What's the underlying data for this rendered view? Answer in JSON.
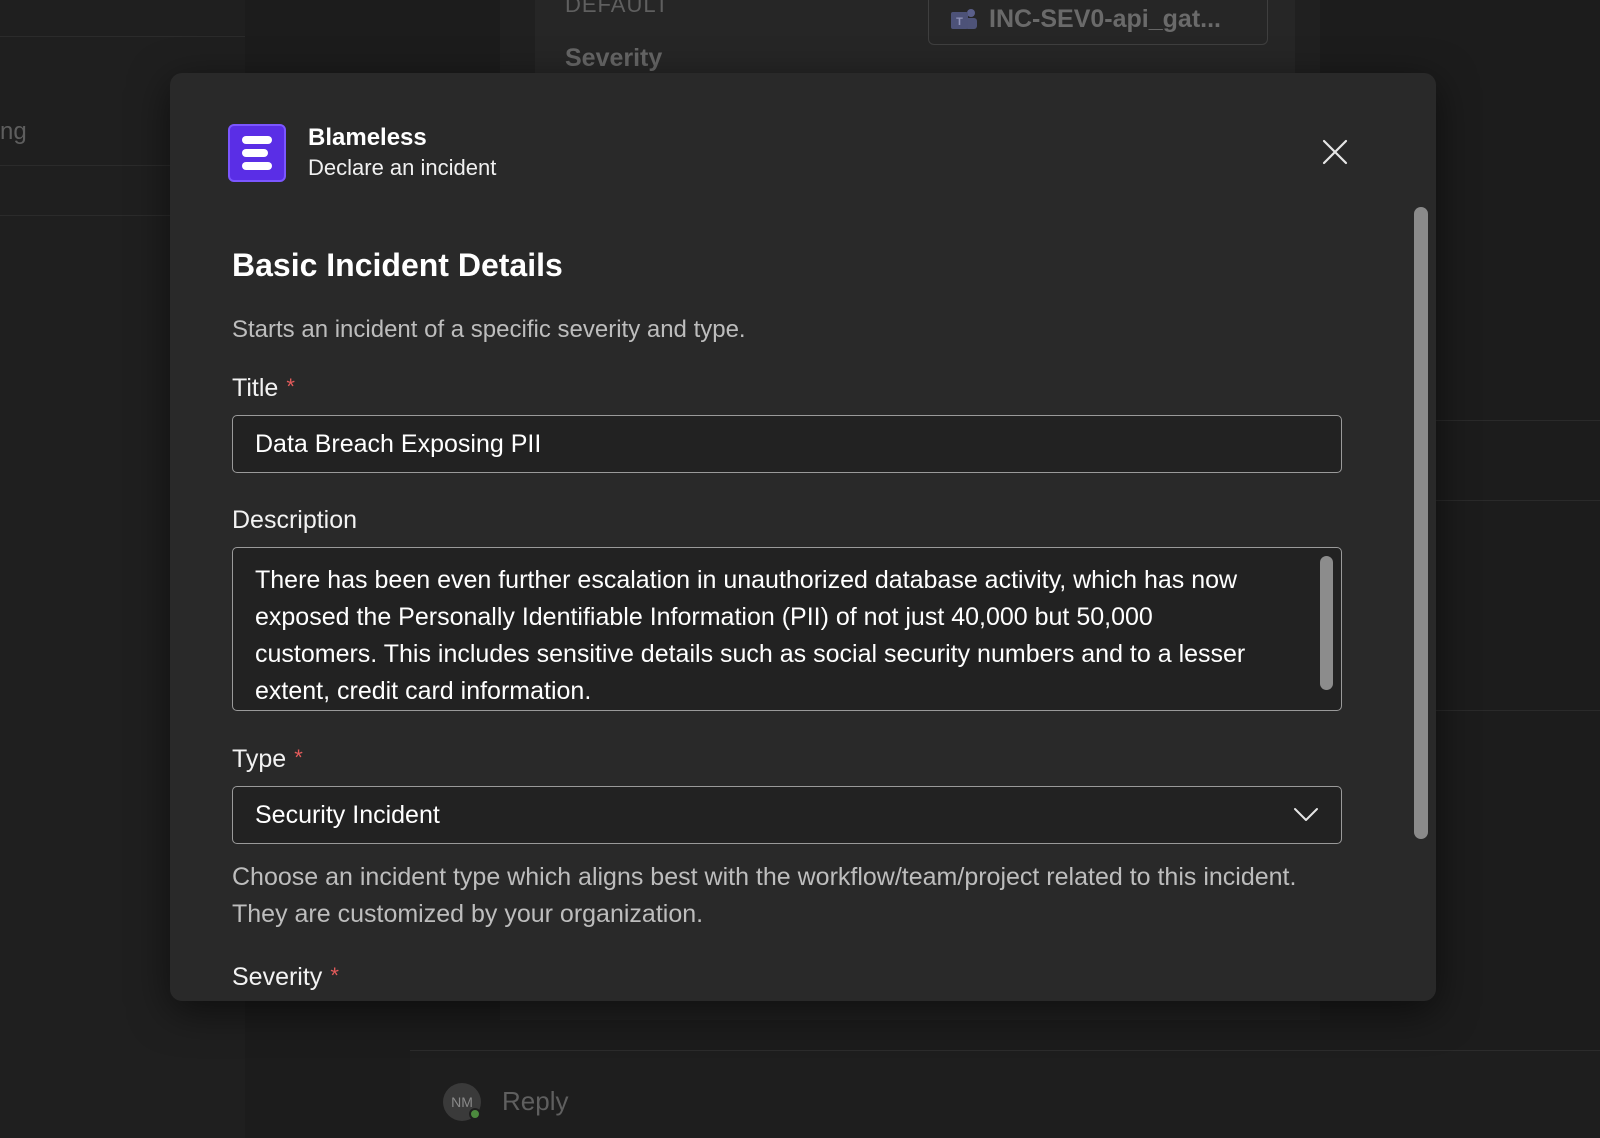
{
  "background": {
    "left_pane_text": "ng",
    "card_label": "DEFAULT",
    "card_severity_label": "Severity",
    "channel_chip": "INC-SEV0-api_gat...",
    "channel_chip_icon": "teams-icon",
    "avatar_initials": "NM",
    "reply_label": "Reply"
  },
  "modal": {
    "app_name": "Blameless",
    "app_subtitle": "Declare an incident",
    "app_logo_icon": "blameless-logo-icon",
    "close_icon": "close-icon",
    "section_title": "Basic Incident Details",
    "section_description": "Starts an incident of a specific severity and type.",
    "required_marker": "*",
    "fields": {
      "title": {
        "label": "Title",
        "value": "Data Breach Exposing PII"
      },
      "description": {
        "label": "Description",
        "value": "There has been even further escalation in unauthorized database activity, which has now exposed the Personally Identifiable Information (PII) of not just 40,000 but 50,000 customers. This includes sensitive details such as social security numbers and to a lesser extent, credit card information."
      },
      "type": {
        "label": "Type",
        "selected": "Security Incident",
        "helper": "Choose an incident type which aligns best with the workflow/team/project related to this incident. They are customized by your organization.",
        "dropdown_icon": "chevron-down-icon"
      },
      "severity": {
        "label": "Severity"
      }
    }
  },
  "colors": {
    "accent_logo": "#5a2ee6",
    "required_star": "#e35b5b",
    "modal_bg": "#292929"
  }
}
